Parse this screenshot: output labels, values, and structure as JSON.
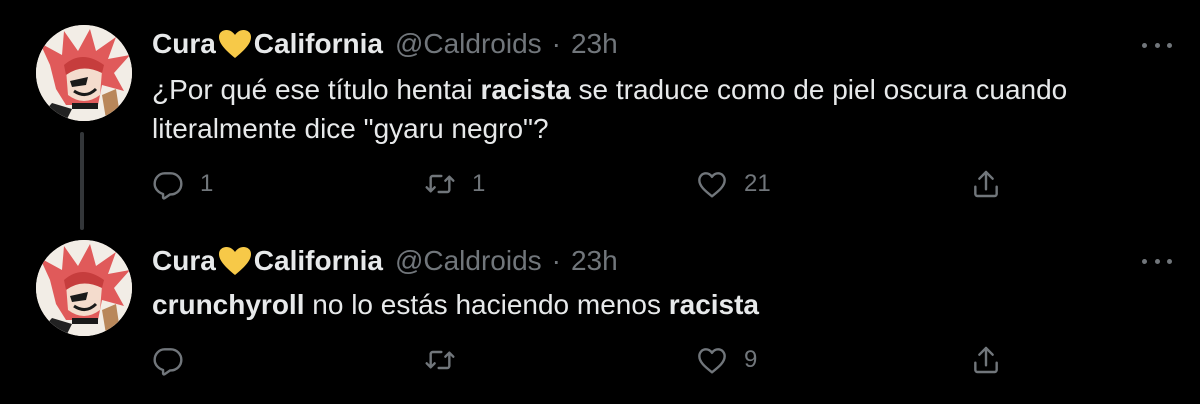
{
  "tweets": [
    {
      "display_name_part1": "Cura",
      "display_name_part2": "California",
      "handle": "@Caldroids",
      "separator": "·",
      "time": "23h",
      "text_1": "¿Por qué ese título hentai ",
      "text_bold_1": "racista",
      "text_2": " se traduce como de piel oscura cuando literalmente dice \"gyaru negro\"?",
      "reply_count": "1",
      "retweet_count": "1",
      "like_count": "21"
    },
    {
      "display_name_part1": "Cura",
      "display_name_part2": "California",
      "handle": "@Caldroids",
      "separator": "·",
      "time": "23h",
      "text_bold_1": "crunchyroll",
      "text_2": " no lo estás haciendo menos ",
      "text_bold_2": "racista",
      "reply_count": "",
      "retweet_count": "",
      "like_count": "9"
    }
  ],
  "icons": {
    "heart_emoji": "yellow-heart-emoji",
    "reply": "reply-icon",
    "retweet": "retweet-icon",
    "like": "like-icon",
    "share": "share-icon",
    "more": "more-icon"
  },
  "colors": {
    "background": "#000000",
    "text": "#e7e9ea",
    "muted": "#71767b",
    "heart_emoji": "#f7c948"
  }
}
